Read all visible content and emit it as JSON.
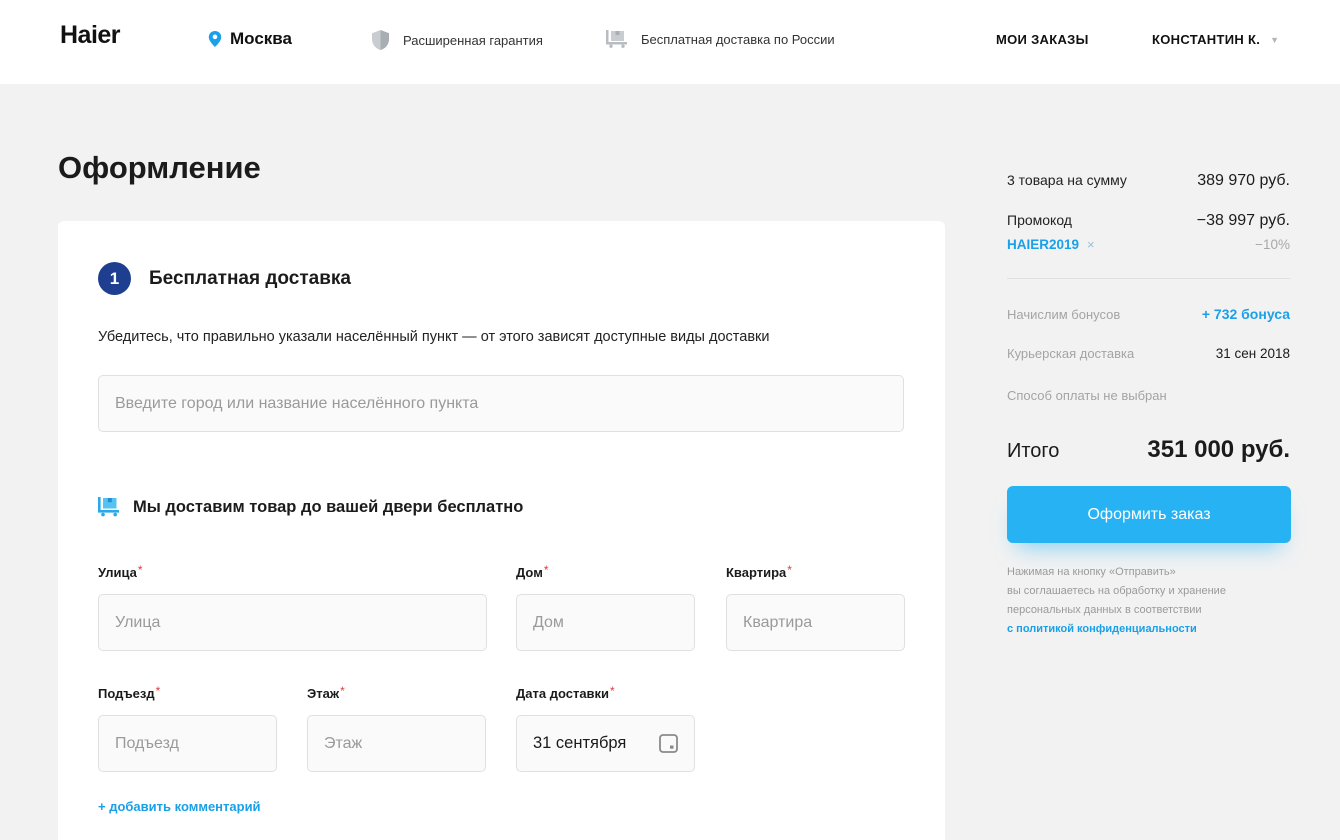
{
  "header": {
    "logo": "Haier",
    "city": "Москва",
    "warranty": "Расширенная гарантия",
    "delivery": "Бесплатная доставка по России",
    "my_orders": "МОИ ЗАКАЗЫ",
    "user": "КОНСТАНТИН К.",
    "caret": "▼"
  },
  "page": {
    "title": "Оформление"
  },
  "step": {
    "number": "1",
    "title": "Бесплатная доставка",
    "hint": "Убедитесь, что правильно указали населённый пункт — от этого зависят доступные виды доставки",
    "city_placeholder": "Введите город или название населённого пункта",
    "door_text": "Мы доставим товар до вашей двери бесплатно"
  },
  "form": {
    "required_mark": "*",
    "street_label": "Улица",
    "street_placeholder": "Улица",
    "house_label": "Дом",
    "house_placeholder": "Дом",
    "apt_label": "Квартира",
    "apt_placeholder": "Квартира",
    "entrance_label": "Подъезд",
    "entrance_placeholder": "Подъезд",
    "floor_label": "Этаж",
    "floor_placeholder": "Этаж",
    "date_label": "Дата доставки",
    "date_value": "31 сентября",
    "add_comment": "+ добавить комментарий"
  },
  "summary": {
    "items_label": "3 товара на сумму",
    "items_value": "389 970 руб.",
    "promo_label": "Промокод",
    "promo_value": "−38 997 руб.",
    "promo_code": "HAIER2019",
    "promo_remove": "×",
    "promo_percent": "−10%",
    "bonus_label": "Начислим бонусов",
    "bonus_value": "+ 732 бонуса",
    "courier_label": "Курьерская доставка",
    "courier_value": "31 сен 2018",
    "payment_note": "Способ оплаты не выбран",
    "total_label": "Итого",
    "total_value": "351 000 руб.",
    "order_button": "Оформить заказ",
    "legal_line1": "Нажимая на кнопку «Отправить»",
    "legal_line2": "вы соглашаетесь на обработку и хранение",
    "legal_line3": "персональных данных в соответствии",
    "legal_link": "с политикой конфиденциальности"
  },
  "colors": {
    "accent": "#27b2f3",
    "link": "#1aa0e8",
    "step_badge": "#1e3f8f",
    "required": "#e53935",
    "background": "#f2f2f2"
  },
  "icons": {
    "city": "location-pin-icon",
    "warranty": "shield-icon",
    "delivery": "truck-box-icon",
    "date": "calendar-icon"
  }
}
